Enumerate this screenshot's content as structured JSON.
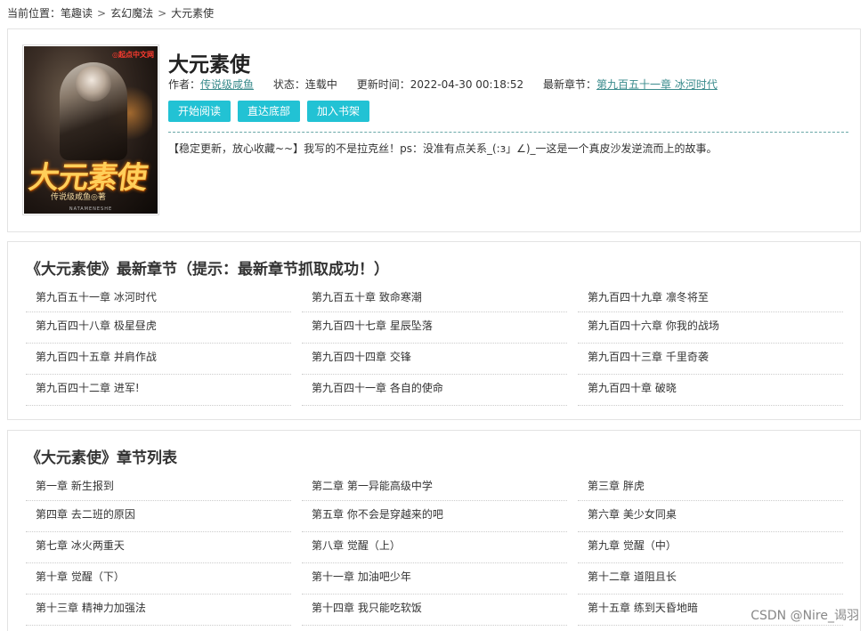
{
  "breadcrumb": {
    "prefix": "当前位置：",
    "items": [
      "笔趣读",
      "玄幻魔法",
      "大元素使"
    ],
    "separator": ">"
  },
  "book": {
    "title": "大元素使",
    "author_label": "作者：",
    "author": "传说级咸鱼",
    "status_label": "状态：",
    "status": "连载中",
    "updated_label": "更新时间：",
    "updated": "2022-04-30 00:18:52",
    "latest_label": "最新章节：",
    "latest": "第九百五十一章 冰河时代",
    "intro": "【稳定更新，放心收藏~~】我写的不是拉克丝！ps：没准有点关系_(:з」∠)_一这是一个真皮沙发逆流而上的故事。",
    "cover": {
      "title_text": "大元素使",
      "subtitle_text": "传说级咸鱼◎著",
      "badge_text": "◎起点中文网",
      "footer_text": "NATAMENESHE"
    }
  },
  "buttons": {
    "read": "开始阅读",
    "bottom": "直达底部",
    "shelf": "加入书架"
  },
  "latest_section": {
    "title": "《大元素使》最新章节（提示：最新章节抓取成功！）",
    "chapters": [
      "第九百五十一章 冰河时代",
      "第九百五十章 致命寒潮",
      "第九百四十九章 凛冬将至",
      "第九百四十八章 极星昼虎",
      "第九百四十七章 星辰坠落",
      "第九百四十六章 你我的战场",
      "第九百四十五章 并肩作战",
      "第九百四十四章 交锋",
      "第九百四十三章 千里奇袭",
      "第九百四十二章 进军!",
      "第九百四十一章 各自的使命",
      "第九百四十章 破晓"
    ]
  },
  "list_section": {
    "title": "《大元素使》章节列表",
    "chapters": [
      "第一章 新生报到",
      "第二章 第一异能高级中学",
      "第三章 胖虎",
      "第四章 去二班的原因",
      "第五章 你不会是穿越来的吧",
      "第六章 美少女同桌",
      "第七章 冰火两重天",
      "第八章 觉醒（上）",
      "第九章 觉醒（中）",
      "第十章 觉醒（下）",
      "第十一章 加油吧少年",
      "第十二章 道阻且长",
      "第十三章 精神力加强法",
      "第十四章 我只能吃软饭",
      "第十五章 练到天昏地暗"
    ]
  },
  "watermark": "CSDN @Nire_谒羽",
  "colors": {
    "button_bg": "#22c2d4",
    "link": "#3a8b8c",
    "border": "#e3e3e3"
  }
}
